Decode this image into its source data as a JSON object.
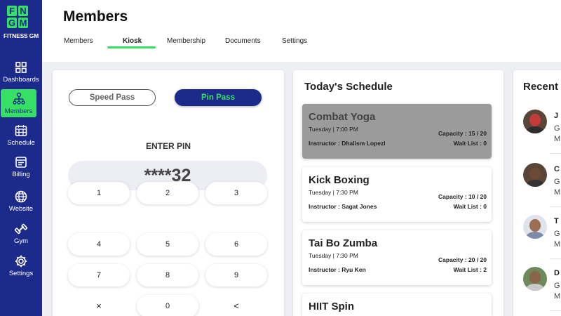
{
  "brand": {
    "logo_letters": [
      "F",
      "N",
      "G",
      "M"
    ],
    "name": "FITNESS GM"
  },
  "sidebar": {
    "items": [
      {
        "label": "Dashboards",
        "icon": "grid-icon",
        "active": false
      },
      {
        "label": "Members",
        "icon": "org-chart-icon",
        "active": true
      },
      {
        "label": "Schedule",
        "icon": "calendar-icon",
        "active": false
      },
      {
        "label": "Billing",
        "icon": "billing-icon",
        "active": false
      },
      {
        "label": "Website",
        "icon": "globe-icon",
        "active": false
      },
      {
        "label": "Gym",
        "icon": "dumbbell-icon",
        "active": false
      },
      {
        "label": "Settings",
        "icon": "gear-icon",
        "active": false
      }
    ]
  },
  "header": {
    "title": "Members",
    "tabs": [
      {
        "label": "Members",
        "active": false
      },
      {
        "label": "Kiosk",
        "active": true
      },
      {
        "label": "Membership",
        "active": false
      },
      {
        "label": "Documents",
        "active": false
      },
      {
        "label": "Settings",
        "active": false
      }
    ]
  },
  "kiosk": {
    "speed_pass_label": "Speed Pass",
    "pin_pass_label": "Pin Pass",
    "enter_pin_label": "ENTER PIN",
    "pin_value": "****32",
    "keys": [
      "1",
      "2",
      "3",
      "4",
      "5",
      "6",
      "7",
      "8",
      "9",
      "×",
      "0",
      "<"
    ]
  },
  "schedule": {
    "title": "Today's Schedule",
    "classes": [
      {
        "name": "Combat Yoga",
        "time": "Tuesday | 7:00 PM",
        "instructor": "Instructor : Dhalism Lopezl",
        "capacity": "Capacity : 15 / 20",
        "wait": "Wait List : 0",
        "selected": true
      },
      {
        "name": "Kick Boxing",
        "time": "Tuesday | 7:30 PM",
        "instructor": "Instructor : Sagat Jones",
        "capacity": "Capacity : 10 / 20",
        "wait": "Wait List : 0",
        "selected": false
      },
      {
        "name": "Tai Bo Zumba",
        "time": "Tuesday | 7:30 PM",
        "instructor": "Instructor : Ryu Ken",
        "capacity": "Capacity : 20 / 20",
        "wait": "Wait List : 2",
        "selected": false
      },
      {
        "name": "HIIT Spin",
        "time": "",
        "instructor": "",
        "capacity": "",
        "wait": "",
        "selected": false
      }
    ]
  },
  "recent": {
    "title": "Recent",
    "members": [
      {
        "name": "J",
        "line2": "G",
        "line3": "M"
      },
      {
        "name": "C",
        "line2": "G",
        "line3": "M"
      },
      {
        "name": "T",
        "line2": "G",
        "line3": "M"
      },
      {
        "name": "D",
        "line2": "G",
        "line3": "M"
      }
    ]
  },
  "colors": {
    "navy": "#1c2a8c",
    "accent_green": "#35e065",
    "selected_card": "#9b9b9b",
    "page_background": "#eeeff3"
  }
}
